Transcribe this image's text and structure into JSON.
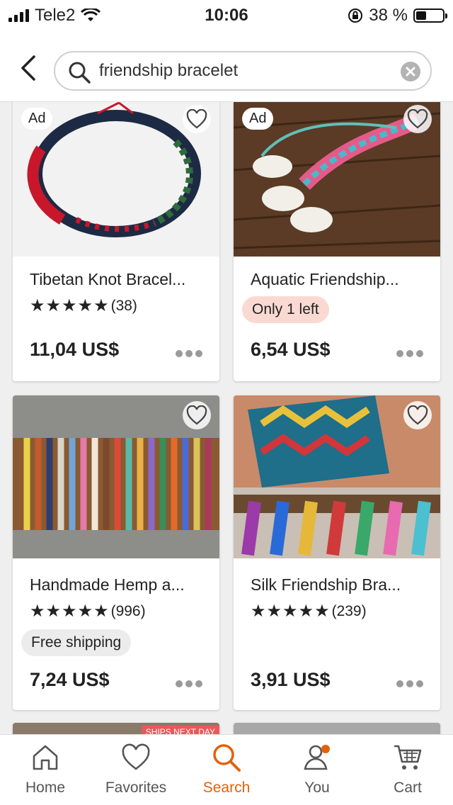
{
  "status_bar": {
    "carrier": "Tele2",
    "time": "10:06",
    "battery_text": "38 %",
    "battery_level": 0.38
  },
  "search": {
    "query": "friendship bracelet"
  },
  "products": [
    {
      "ad_label": "Ad",
      "title": "Tibetan Knot Bracel...",
      "rating_count": "(38)",
      "price": "11,04 US$"
    },
    {
      "ad_label": "Ad",
      "title": "Aquatic Friendship...",
      "badge": "Only 1 left",
      "price": "6,54 US$"
    },
    {
      "title": "Handmade Hemp a...",
      "rating_count": "(996)",
      "badge": "Free shipping",
      "price": "7,24 US$"
    },
    {
      "title": "Silk Friendship Bra...",
      "rating_count": "(239)",
      "price": "3,91 US$"
    }
  ],
  "partial_banner": "SHIPS NEXT DAY",
  "tabs": [
    {
      "label": "Home",
      "icon": "home-icon"
    },
    {
      "label": "Favorites",
      "icon": "heart-icon"
    },
    {
      "label": "Search",
      "icon": "search-icon",
      "active": true
    },
    {
      "label": "You",
      "icon": "user-icon"
    },
    {
      "label": "Cart",
      "icon": "cart-icon"
    }
  ],
  "colors": {
    "accent": "#e5600b",
    "only_left_bg": "#fbd9d3",
    "free_shipping_bg": "#ececec"
  }
}
